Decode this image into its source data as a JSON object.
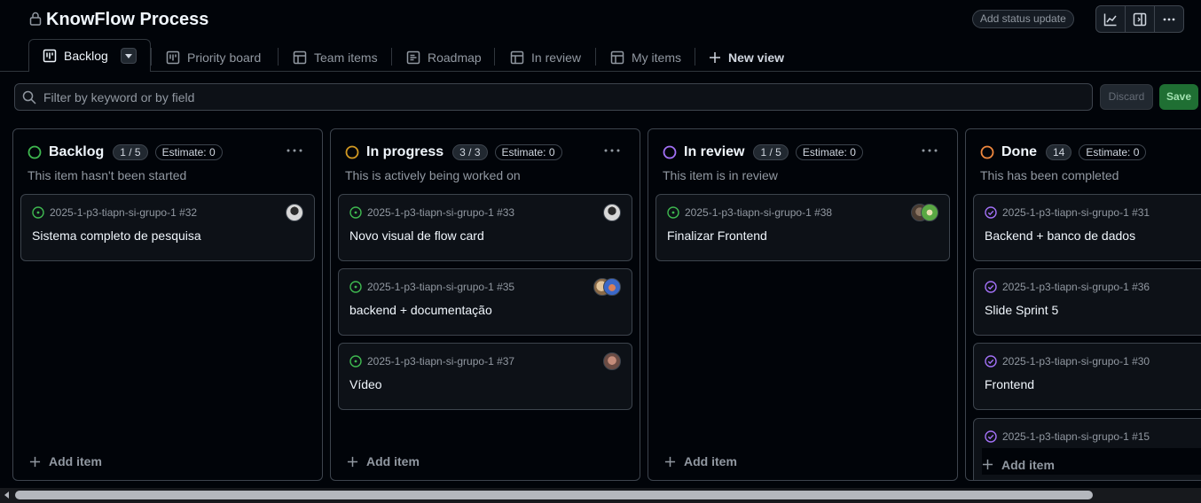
{
  "header": {
    "title": "KnowFlow Process",
    "status_update_label": "Add status update"
  },
  "icons": {
    "lock": "lock-icon",
    "insights": "graph-icon",
    "panel": "sidebar-expand-icon",
    "more": "kebab-horizontal-icon",
    "search": "search-icon",
    "plus": "plus-icon",
    "issue_open": "issue-opened-icon",
    "issue_closed": "issue-closed-icon"
  },
  "tabs": [
    {
      "label": "Backlog",
      "icon": "project-board-icon"
    },
    {
      "label": "Priority board",
      "icon": "project-board-icon"
    },
    {
      "label": "Team items",
      "icon": "table-icon"
    },
    {
      "label": "Roadmap",
      "icon": "roadmap-icon"
    },
    {
      "label": "In review",
      "icon": "table-icon"
    },
    {
      "label": "My items",
      "icon": "table-icon"
    },
    {
      "label": "New view",
      "icon": "plus-icon"
    }
  ],
  "filter": {
    "placeholder": "Filter by keyword or by field",
    "value": "",
    "discard_label": "Discard",
    "save_label": "Save"
  },
  "colors": {
    "backlog": "#3fb950",
    "in_progress": "#d29922",
    "in_review": "#a371f7",
    "done": "#f0883e",
    "issue_open": "#3fb950",
    "issue_closed": "#a371f7"
  },
  "columns": [
    {
      "name": "Backlog",
      "count": "1 / 5",
      "estimate": "Estimate: 0",
      "description": "This item hasn't been started",
      "add_label": "Add item",
      "cards": [
        {
          "ref": "2025-1-p3-tiapn-si-grupo-1 #32",
          "title": "Sistema completo de pesquisa",
          "state": "open"
        }
      ]
    },
    {
      "name": "In progress",
      "count": "3 / 3",
      "estimate": "Estimate: 0",
      "description": "This is actively being worked on",
      "add_label": "Add item",
      "cards": [
        {
          "ref": "2025-1-p3-tiapn-si-grupo-1 #33",
          "title": "Novo visual de flow card",
          "state": "open"
        },
        {
          "ref": "2025-1-p3-tiapn-si-grupo-1 #35",
          "title": "backend + documentação",
          "state": "open"
        },
        {
          "ref": "2025-1-p3-tiapn-si-grupo-1 #37",
          "title": "Vídeo",
          "state": "open"
        }
      ]
    },
    {
      "name": "In review",
      "count": "1 / 5",
      "estimate": "Estimate: 0",
      "description": "This item is in review",
      "add_label": "Add item",
      "cards": [
        {
          "ref": "2025-1-p3-tiapn-si-grupo-1 #38",
          "title": "Finalizar Frontend",
          "state": "open"
        }
      ]
    },
    {
      "name": "Done",
      "count": "14",
      "estimate": "Estimate: 0",
      "description": "This has been completed",
      "add_label": "Add item",
      "cards": [
        {
          "ref": "2025-1-p3-tiapn-si-grupo-1 #31",
          "title": "Backend + banco de dados",
          "state": "closed"
        },
        {
          "ref": "2025-1-p3-tiapn-si-grupo-1 #36",
          "title": "Slide Sprint 5",
          "state": "closed"
        },
        {
          "ref": "2025-1-p3-tiapn-si-grupo-1 #30",
          "title": "Frontend",
          "state": "closed"
        },
        {
          "ref": "2025-1-p3-tiapn-si-grupo-1 #15",
          "title": "",
          "state": "closed"
        }
      ]
    }
  ]
}
